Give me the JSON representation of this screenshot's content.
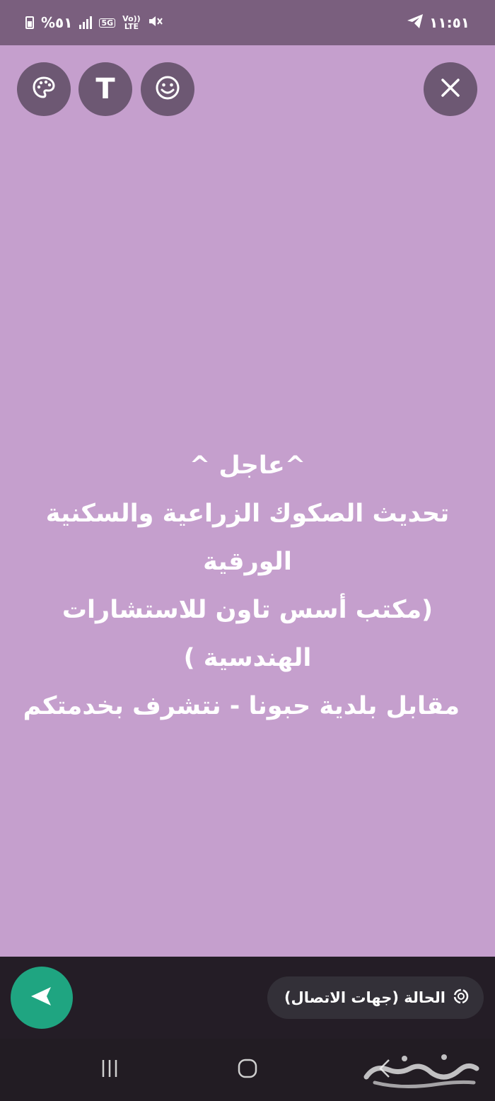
{
  "status_bar": {
    "time": "١١:٥١",
    "battery_text": "%٥١",
    "network_5g": "5G",
    "volte_top": "Vo))",
    "volte_bottom": "LTE"
  },
  "toolbar": {
    "close_icon": "close-icon",
    "emoji_icon": "smiley-icon",
    "text_tool_label": "T",
    "palette_icon": "palette-icon"
  },
  "status_text": {
    "lines": [
      "^عاجل ^",
      "تحديث الصكوك الزراعية والسكنية",
      "الورقية",
      "(مكتب أسس تاون للاستشارات",
      "الهندسية )",
      "مقابل بلدية حبونا - نتشرف بخدمتكم"
    ]
  },
  "composer": {
    "audience_label": "الحالة (جهات الاتصال)",
    "send_icon": "send-icon"
  },
  "colors": {
    "canvas": "#c59fcd",
    "status_bar": "#7a5f7e",
    "accent": "#1fa581"
  }
}
